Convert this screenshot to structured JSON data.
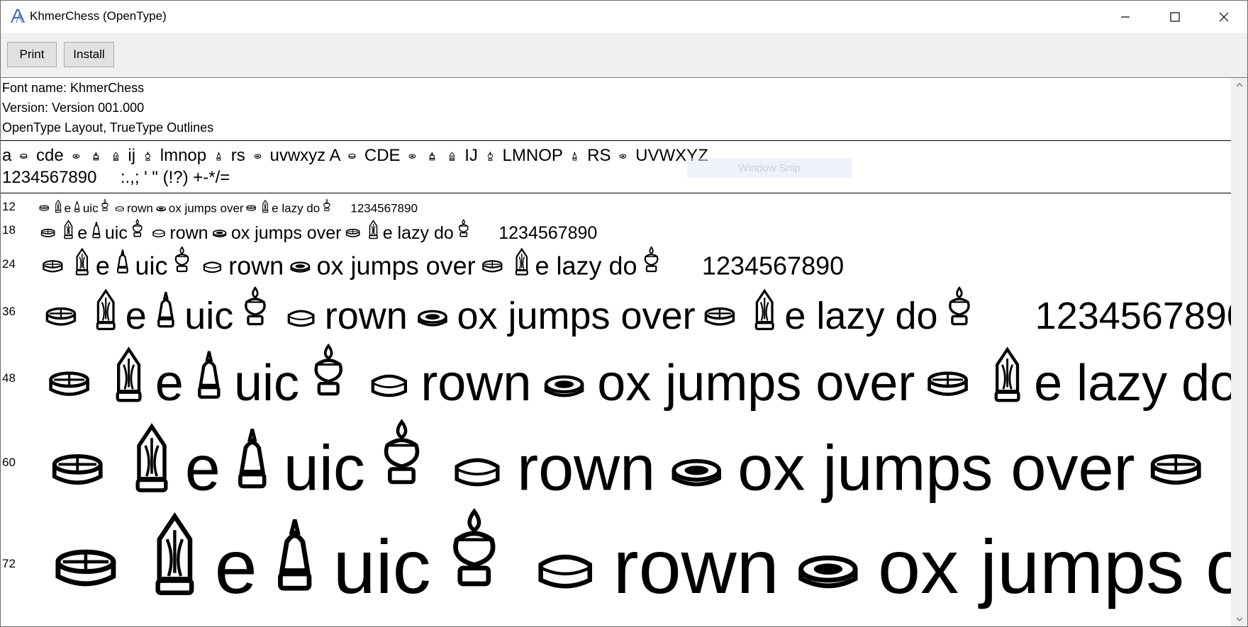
{
  "window": {
    "title": "KhmerChess (OpenType)"
  },
  "toolbar": {
    "print_label": "Print",
    "install_label": "Install"
  },
  "info": {
    "font_name": "Font name: KhmerChess",
    "version": "Version: Version 001.000",
    "layout": "OpenType Layout, TrueType Outlines"
  },
  "charset": {
    "line1_parts": [
      "a",
      "cde",
      "ij",
      "lmnop",
      "rs",
      "uvwxyz A",
      "CDE",
      "IJ",
      "LMNOP",
      "RS",
      "UVWXYZ"
    ],
    "line2": "1234567890     :.,; ' \" (!?) +-*/="
  },
  "ghost_text": "Window Snip",
  "sample_words": [
    "e",
    "uic",
    "rown",
    "ox jumps over",
    "e lazy do",
    "1234567890"
  ],
  "sizes": [
    "12",
    "18",
    "24",
    "36",
    "48",
    "60",
    "72"
  ],
  "icons": [
    "app-font-icon",
    "minimize-icon",
    "maximize-icon",
    "close-icon",
    "scroll-up-icon",
    "scroll-down-icon"
  ]
}
